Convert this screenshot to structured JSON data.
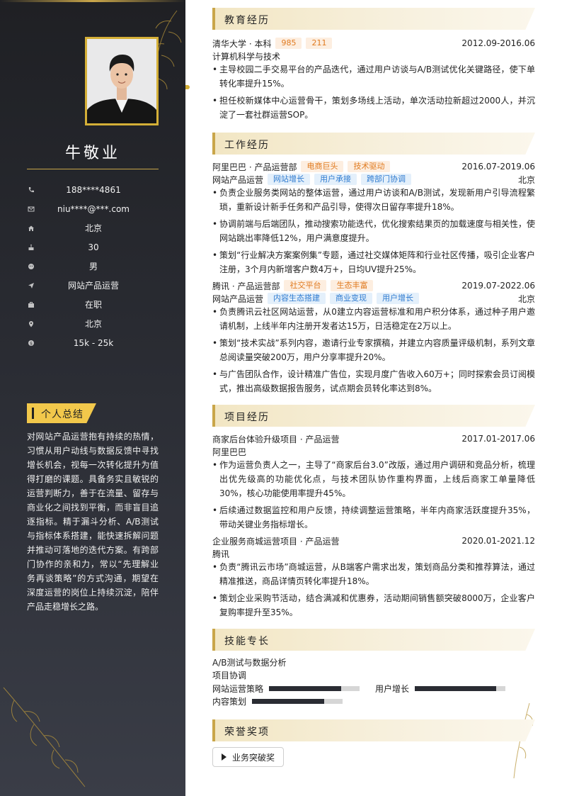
{
  "profile": {
    "name": "牛敬业",
    "info": [
      {
        "icon": "phone-icon",
        "value": "188****4861"
      },
      {
        "icon": "mail-icon",
        "value": "niu****@***.com"
      },
      {
        "icon": "home-icon",
        "value": "北京"
      },
      {
        "icon": "cake-icon",
        "value": "30"
      },
      {
        "icon": "gender-icon",
        "value": "男"
      },
      {
        "icon": "send-icon",
        "value": "网站产品运营"
      },
      {
        "icon": "briefcase-icon",
        "value": "在职"
      },
      {
        "icon": "location-pin-icon",
        "value": "北京"
      },
      {
        "icon": "salary-icon",
        "value": "15k - 25k"
      }
    ],
    "summary_title": "个人总结",
    "summary": "对网站产品运营抱有持续的热情，习惯从用户动线与数据反馈中寻找增长机会，视每一次转化提升为值得打磨的课题。具备务实且敏锐的运营判断力，善于在流量、留存与商业化之间找到平衡，而非盲目追逐指标。精于漏斗分析、A/B测试与指标体系搭建，能快速拆解问题并推动可落地的迭代方案。有跨部门协作的亲和力，常以“先理解业务再谈策略”的方式沟通，期望在深度运营的岗位上持续沉淀，陪伴产品走稳增长之路。"
  },
  "education": {
    "title": "教育经历",
    "school": "清华大学 · 本科",
    "tags": [
      "985",
      "211"
    ],
    "date": "2012.09-2016.06",
    "major": "计算机科学与技术",
    "bullets": [
      "主导校园二手交易平台的产品迭代，通过用户访谈与A/B测试优化关键路径，使下单转化率提升15%。",
      "担任校新媒体中心运营骨干，策划多场线上活动，单次活动拉新超过2000人，并沉淀了一套社群运营SOP。"
    ]
  },
  "work": {
    "title": "工作经历",
    "jobs": [
      {
        "company": "阿里巴巴 · 产品运营部",
        "company_tags": [
          "电商巨头",
          "技术驱动"
        ],
        "date": "2016.07-2019.06",
        "role": "网站产品运营",
        "role_tags": [
          "网站增长",
          "用户承接",
          "跨部门协调"
        ],
        "city": "北京",
        "bullets": [
          "负责企业服务类网站的整体运营，通过用户访谈和A/B测试，发现新用户引导流程繁琐，重新设计新手任务和产品引导，使得次日留存率提升18%。",
          "协调前端与后端团队，推动搜索功能迭代，优化搜索结果页的加载速度与相关性，使网站跳出率降低12%，用户满意度提升。",
          "策划“行业解决方案案例集”专题，通过社交媒体矩阵和行业社区传播，吸引企业客户注册，3个月内新增客户数4万+，日均UV提升25%。"
        ]
      },
      {
        "company": "腾讯 · 产品运营部",
        "company_tags": [
          "社交平台",
          "生态丰富"
        ],
        "date": "2019.07-2022.06",
        "role": "网站产品运营",
        "role_tags": [
          "内容生态搭建",
          "商业变现",
          "用户增长"
        ],
        "city": "北京",
        "bullets": [
          "负责腾讯云社区网站运营，从0建立内容运营标准和用户积分体系，通过种子用户邀请机制，上线半年内注册开发者达15万，日活稳定在2万以上。",
          "策划“技术实战”系列内容，邀请行业专家撰稿，并建立内容质量评级机制，系列文章总阅读量突破200万，用户分享率提升20%。",
          "与广告团队合作，设计精准广告位，实现月度广告收入60万+；同时探索会员订阅模式，推出高级数据报告服务，试点期会员转化率达到8%。"
        ]
      }
    ]
  },
  "projects": {
    "title": "项目经历",
    "items": [
      {
        "name": "商家后台体验升级项目 · 产品运营",
        "date": "2017.01-2017.06",
        "org": "阿里巴巴",
        "bullets": [
          "作为运营负责人之一，主导了“商家后台3.0”改版，通过用户调研和竞品分析，梳理出优先级高的功能优化点，与技术团队协作重构界面，上线后商家工单量降低30%，核心功能使用率提升45%。",
          "后续通过数据监控和用户反馈，持续调整运营策略，半年内商家活跃度提升35%，带动关键业务指标增长。"
        ]
      },
      {
        "name": "企业服务商城运营项目 · 产品运营",
        "date": "2020.01-2021.12",
        "org": "腾讯",
        "bullets": [
          "负责“腾讯云市场”商城运营，从B端客户需求出发，策划商品分类和推荐算法，通过精准推送，商品详情页转化率提升18%。",
          "策划企业采购节活动，结合满减和优惠券，活动期间销售额突破8000万，企业客户复购率提升至35%。"
        ]
      }
    ]
  },
  "skills": {
    "title": "技能专长",
    "text_items": [
      "A/B测试与数据分析",
      "项目协调"
    ],
    "bars": [
      {
        "name": "网站运营策略",
        "level": 0.8
      },
      {
        "name": "用户增长",
        "level": 0.9
      },
      {
        "name": "内容策划",
        "level": 0.8
      }
    ]
  },
  "awards": {
    "title": "荣誉奖项",
    "items": [
      "业务突破奖"
    ]
  }
}
